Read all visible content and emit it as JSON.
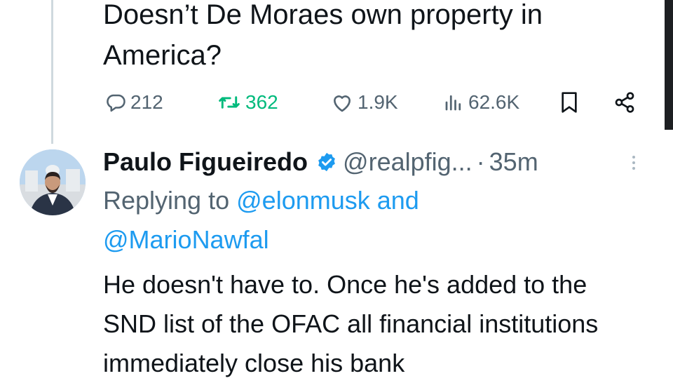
{
  "previous_tweet": {
    "text": "Doesn’t De Moraes own property in America?"
  },
  "actions": {
    "replies": "212",
    "reposts": "362",
    "likes": "1.9K",
    "views": "62.6K"
  },
  "reply": {
    "author_name": "Paulo Figueiredo",
    "handle": "@realpfig...",
    "separator": "·",
    "time": "35m",
    "replying_prefix": "Replying to",
    "mention_1": "@elonmusk",
    "conjunction": "and",
    "mention_2": "@MarioNawfal",
    "text": "He doesn't have to. Once he's added to the SND list of the OFAC all financial institutions immediately close his bank"
  },
  "colors": {
    "repost_green": "#00ba7c",
    "link_blue": "#1d9bf0",
    "secondary_gray": "#536471",
    "verified_blue": "#1d9bf0"
  },
  "icons": [
    "reply-icon",
    "repost-icon",
    "like-icon",
    "views-icon",
    "bookmark-icon",
    "share-icon",
    "verified-badge-icon",
    "more-icon"
  ]
}
